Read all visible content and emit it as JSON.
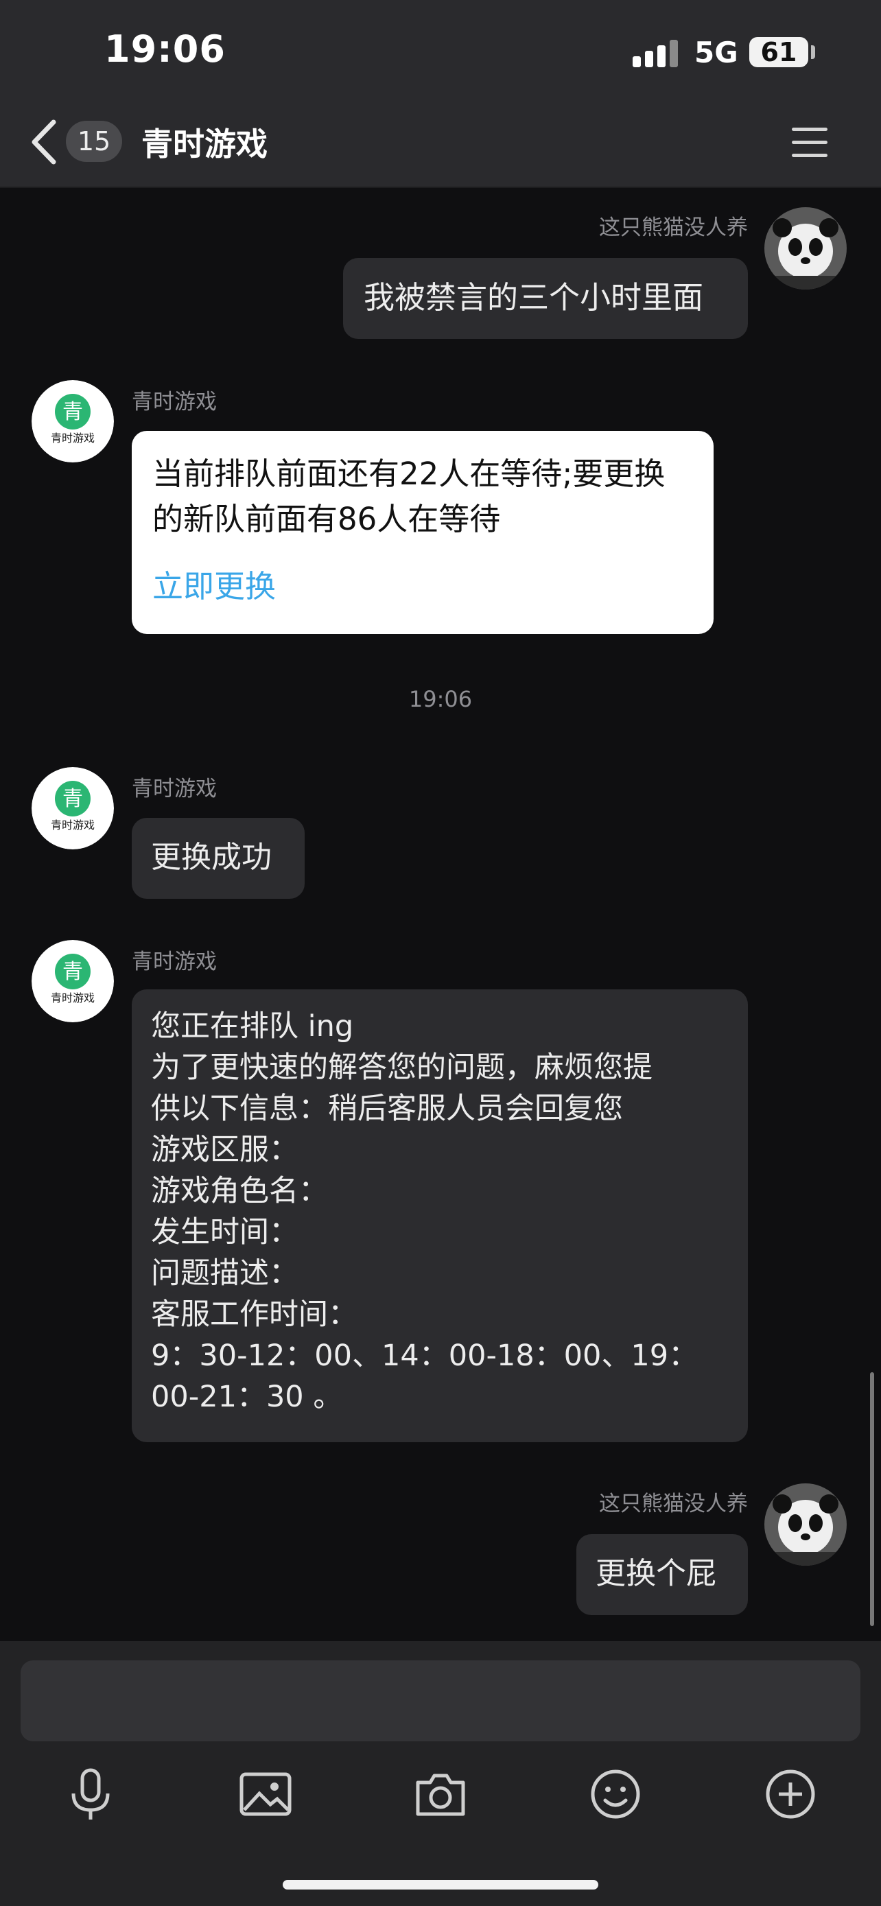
{
  "status_bar": {
    "time": "19:06",
    "network": "5G",
    "battery": "61"
  },
  "header": {
    "back_count": "15",
    "title": "青时游戏"
  },
  "messages": [
    {
      "sender": "这只熊猫没人养",
      "text": "我被禁言的三个小时里面"
    },
    {
      "sender": "青时游戏",
      "lines": [
        "当前排队前面还有22人在等待;要更换",
        "的新队前面有86人在等待"
      ],
      "action": "立即更换"
    },
    {
      "timestamp": "19:06"
    },
    {
      "sender": "青时游戏",
      "text": "更换成功"
    },
    {
      "sender": "青时游戏",
      "lines": [
        "您正在排队 ing",
        "为了更快速的解答您的问题，麻烦您提",
        "供以下信息：稍后客服人员会回复您",
        "游戏区服：",
        "游戏角色名：",
        "发生时间：",
        "问题描述：",
        "客服工作时间：",
        "9：30-12：00、14：00-18：00、19：",
        "00-21：30 。"
      ]
    },
    {
      "sender": "这只熊猫没人养",
      "text": "更换个屁"
    }
  ],
  "bot_avatar_text": "青时游戏",
  "toolbar": {
    "icons": [
      "microphone-icon",
      "image-icon",
      "camera-icon",
      "emoji-icon",
      "plus-icon"
    ]
  },
  "colors": {
    "link": "#3aa6e8",
    "brand_green": "#2bb673"
  }
}
